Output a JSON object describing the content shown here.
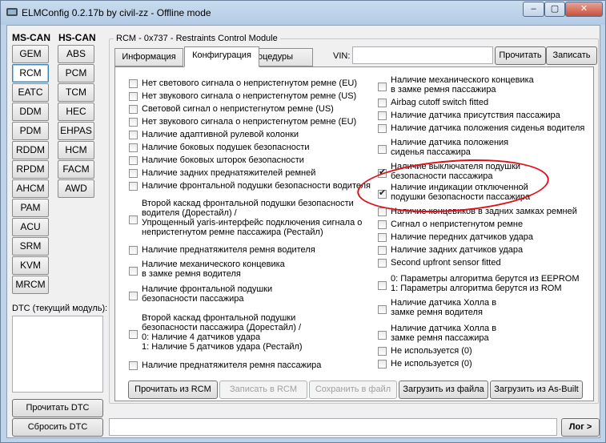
{
  "window": {
    "title": "ELMConfig 0.2.17b by civil-zz - Offline mode",
    "controls": {
      "minimize": "–",
      "maximize": "▢",
      "close": "✕"
    }
  },
  "sidebar": {
    "ms_can_title": "MS-CAN",
    "hs_can_title": "HS-CAN",
    "ms_can": [
      "GEM",
      "RCM",
      "EATC",
      "DDM",
      "PDM",
      "RDDM",
      "RPDM",
      "AHCM",
      "PAM",
      "ACU",
      "SRM",
      "KVM",
      "MRCM"
    ],
    "hs_can": [
      "ABS",
      "PCM",
      "TCM",
      "HEC",
      "EHPAS",
      "HCM",
      "FACM",
      "AWD"
    ],
    "active": "RCM",
    "dtc_label": "DTC (текущий модуль):",
    "read_dtc": "Прочитать DTC",
    "clear_dtc": "Сбросить DTC"
  },
  "module": {
    "title": "RCM - 0x737 - Restraints Control Module",
    "tabs": [
      "Информация",
      "Конфигурация",
      "Процедуры"
    ],
    "active_tab": "Конфигурация",
    "vin_label": "VIN:",
    "vin_value": "",
    "read_button": "Прочитать",
    "write_button": "Записать"
  },
  "options_left": [
    {
      "label": "Нет светового сигнала о непристегнутом ремне (EU)",
      "checked": false
    },
    {
      "label": "Нет звукового сигнала о непристегнутом ремне (US)",
      "checked": false
    },
    {
      "label": "Световой сигнал о непристегнутом ремне (US)",
      "checked": false
    },
    {
      "label": "Нет звукового сигнала о непристегнутом ремне (EU)",
      "checked": false
    },
    {
      "label": "Наличие адаптивной рулевой колонки",
      "checked": false
    },
    {
      "label": "Наличие боковых подушек безопасности",
      "checked": false
    },
    {
      "label": "Наличие боковых шторок безопасности",
      "checked": false
    },
    {
      "label": "Наличие задних преднатяжителей ремней",
      "checked": false
    },
    {
      "label": "Наличие фронтальной подушки безопасности водителя",
      "checked": false
    },
    {
      "lines": [
        "Второй каскад фронтальной подушки безопасности",
        "водителя (Дорестайл) /",
        "Упрощенный yaris-интерфейс подключения сигнала о",
        "непристегнутом ремне пассажира (Рестайл)"
      ],
      "checked": false
    },
    {
      "label": "Наличие преднатяжителя ремня водителя",
      "checked": false
    },
    {
      "lines": [
        "Наличие механического концевика",
        "в замке ремня водителя"
      ],
      "checked": false
    },
    {
      "lines": [
        "Наличие фронтальной подушки",
        "безопасности пассажира"
      ],
      "checked": false
    },
    {
      "lines": [
        "Второй каскад фронтальной подушки",
        "безопасности пассажира (Дорестайл) /",
        "0: Наличие 4 датчиков удара",
        "1: Наличие 5 датчиков удара (Рестайл)"
      ],
      "checked": false
    },
    {
      "label": "Наличие преднатяжителя ремня пассажира",
      "checked": false
    }
  ],
  "options_right": [
    {
      "lines": [
        "Наличие механического концевика",
        "в замке ремня пассажира"
      ],
      "checked": false
    },
    {
      "label": "Airbag cutoff switch fitted",
      "checked": false
    },
    {
      "label": "Наличие датчика присутствия пассажира",
      "checked": false
    },
    {
      "label": "Наличие датчика положения сиденья водителя",
      "checked": false
    },
    {
      "lines": [
        "Наличие датчика положения",
        "сиденья пассажира"
      ],
      "checked": false
    },
    {
      "lines": [
        "Наличие выключателя подушки",
        "безопасности пассажира"
      ],
      "checked": true
    },
    {
      "lines": [
        "Наличие индикации отключенной",
        "подушки безопасности пассажира"
      ],
      "checked": true
    },
    {
      "label": "Наличие концевиков в задних замках ремней",
      "checked": false
    },
    {
      "label": "Сигнал о непристегнутом ремне",
      "checked": false
    },
    {
      "label": "Наличие передних датчиков удара",
      "checked": false
    },
    {
      "label": "Наличие задних датчиков удара",
      "checked": false
    },
    {
      "label": "Second upfront sensor fitted",
      "checked": false
    },
    {
      "lines": [
        "0: Параметры алгоритма берутся из EEPROM",
        "1: Параметры алгоритма берутся из ROM"
      ],
      "checked": false
    },
    {
      "lines": [
        "Наличие датчика Холла в",
        "замке ремня водителя"
      ],
      "checked": false
    },
    {
      "lines": [
        "Наличие датчика Холла в",
        "замке ремня пассажира"
      ],
      "checked": false
    },
    {
      "label": "Не используется (0)",
      "checked": false
    },
    {
      "label": "Не используется (0)",
      "checked": false
    }
  ],
  "actions": {
    "read_rcm": "Прочитать из RCM",
    "write_rcm": "Записать в RCM",
    "save_file": "Сохранить в файл",
    "load_file": "Загрузить из файла",
    "load_asbuilt": "Загрузить из As-Built"
  },
  "status": {
    "log_button": "Лог >",
    "text": ""
  },
  "colors": {
    "highlight_marker": "#e0101a",
    "window_frame": "#bfd3e8"
  }
}
